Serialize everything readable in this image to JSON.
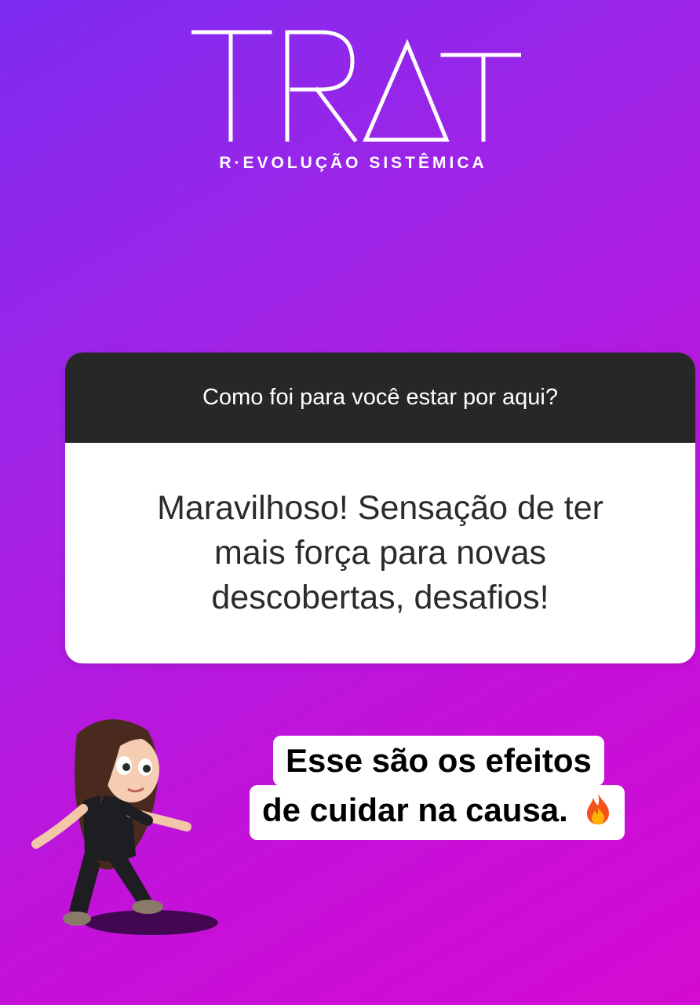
{
  "brand": {
    "logo_text": "TRAT",
    "subtitle": "R·EVOLUÇÃO SISTÊMICA"
  },
  "question_sticker": {
    "question": "Como foi para você estar por aqui?",
    "answer": "Maravilhoso! Sensação de ter mais força para novas descobertas, desafios!"
  },
  "caption": {
    "line1": "Esse são os efeitos",
    "line2": "de cuidar na causa."
  },
  "icons": {
    "caption_emoji": "fire-icon",
    "sticker": "bitmoji-avatar"
  },
  "colors": {
    "background_start": "#7d2cf0",
    "background_end": "#d40bd2",
    "header_bg": "#272727"
  }
}
